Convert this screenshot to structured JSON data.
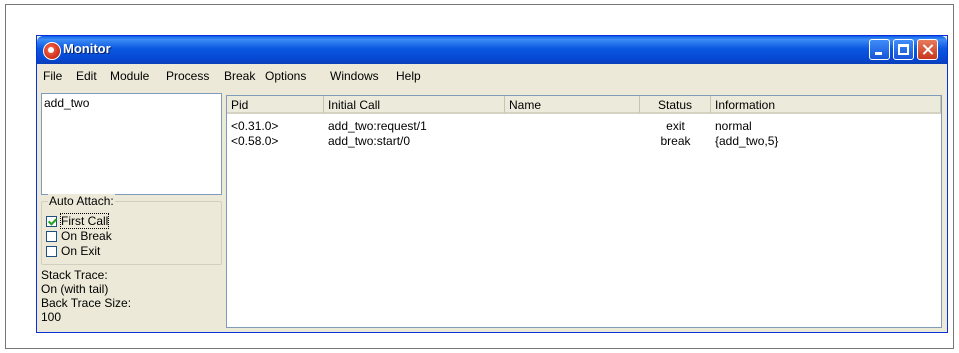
{
  "window": {
    "title": "Monitor",
    "controls": {
      "minimize_icon": "minimize-icon",
      "maximize_icon": "maximize-icon",
      "close_icon": "close-icon"
    }
  },
  "menu": [
    "File",
    "Edit",
    "Module",
    "Process",
    "Break",
    "Options",
    "Windows",
    "Help"
  ],
  "left_panel": {
    "module_list": [
      "add_two"
    ],
    "auto_attach": {
      "title": "Auto Attach:",
      "options": [
        {
          "label": "First Call",
          "checked": true
        },
        {
          "label": "On Break",
          "checked": false
        },
        {
          "label": "On Exit",
          "checked": false
        }
      ]
    },
    "stack_trace_label": "Stack Trace:",
    "stack_trace_value": "On (with tail)",
    "back_trace_label": "Back Trace Size:",
    "back_trace_value": "100"
  },
  "table": {
    "columns": [
      "Pid",
      "Initial Call",
      "Name",
      "Status",
      "Information"
    ],
    "rows": [
      {
        "pid": "<0.31.0>",
        "initial_call": "add_two:request/1",
        "name": "",
        "status": "exit",
        "information": "normal"
      },
      {
        "pid": "<0.58.0>",
        "initial_call": "add_two:start/0",
        "name": "",
        "status": "break",
        "information": "{add_two,5}"
      }
    ]
  },
  "colors": {
    "titlebar": "#0b58e0",
    "window_face": "#ece9d8",
    "close_button": "#c8371e"
  }
}
